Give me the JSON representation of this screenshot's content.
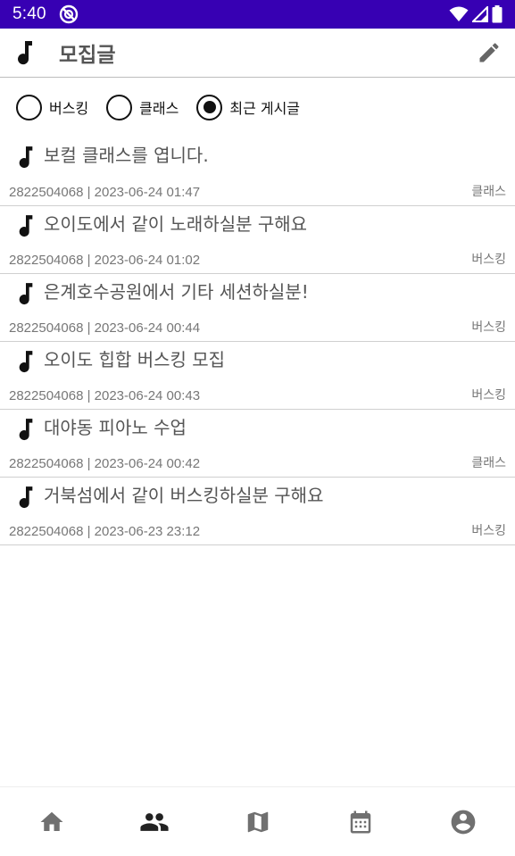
{
  "status_bar": {
    "time": "5:40",
    "icons": [
      "app-notification-icon",
      "wifi-icon",
      "cellular-signal-icon",
      "battery-icon"
    ]
  },
  "app_bar": {
    "title": "모집글",
    "leading_icon": "music-note-icon",
    "action_icon": "edit-pencil-icon"
  },
  "filters": {
    "options": [
      {
        "label": "버스킹",
        "selected": false
      },
      {
        "label": "클래스",
        "selected": false
      },
      {
        "label": "최근 게시글",
        "selected": true
      }
    ]
  },
  "posts": [
    {
      "title": "보컬 클래스를 엽니다.",
      "meta": "2822504068 | 2023-06-24 01:47",
      "category": "클래스"
    },
    {
      "title": "오이도에서 같이 노래하실분 구해요",
      "meta": "2822504068 | 2023-06-24 01:02",
      "category": "버스킹"
    },
    {
      "title": "은계호수공원에서 기타 세션하실분!",
      "meta": "2822504068 | 2023-06-24 00:44",
      "category": "버스킹"
    },
    {
      "title": "오이도 힙합 버스킹 모집",
      "meta": "2822504068 | 2023-06-24 00:43",
      "category": "버스킹"
    },
    {
      "title": "대야동 피아노 수업",
      "meta": "2822504068 | 2023-06-24 00:42",
      "category": "클래스"
    },
    {
      "title": "거북섬에서 같이 버스킹하실분 구해요",
      "meta": "2822504068 | 2023-06-23 23:12",
      "category": "버스킹"
    }
  ],
  "bottom_nav": {
    "items": [
      {
        "icon": "home-icon",
        "active": false
      },
      {
        "icon": "people-icon",
        "active": true
      },
      {
        "icon": "map-icon",
        "active": false
      },
      {
        "icon": "calendar-icon",
        "active": false
      },
      {
        "icon": "account-circle-icon",
        "active": false
      }
    ]
  },
  "colors": {
    "status_bar": "#3700b3",
    "nav_active": "#222222",
    "nav_inactive": "#707070",
    "text_primary": "#555555",
    "text_meta": "#777777"
  }
}
